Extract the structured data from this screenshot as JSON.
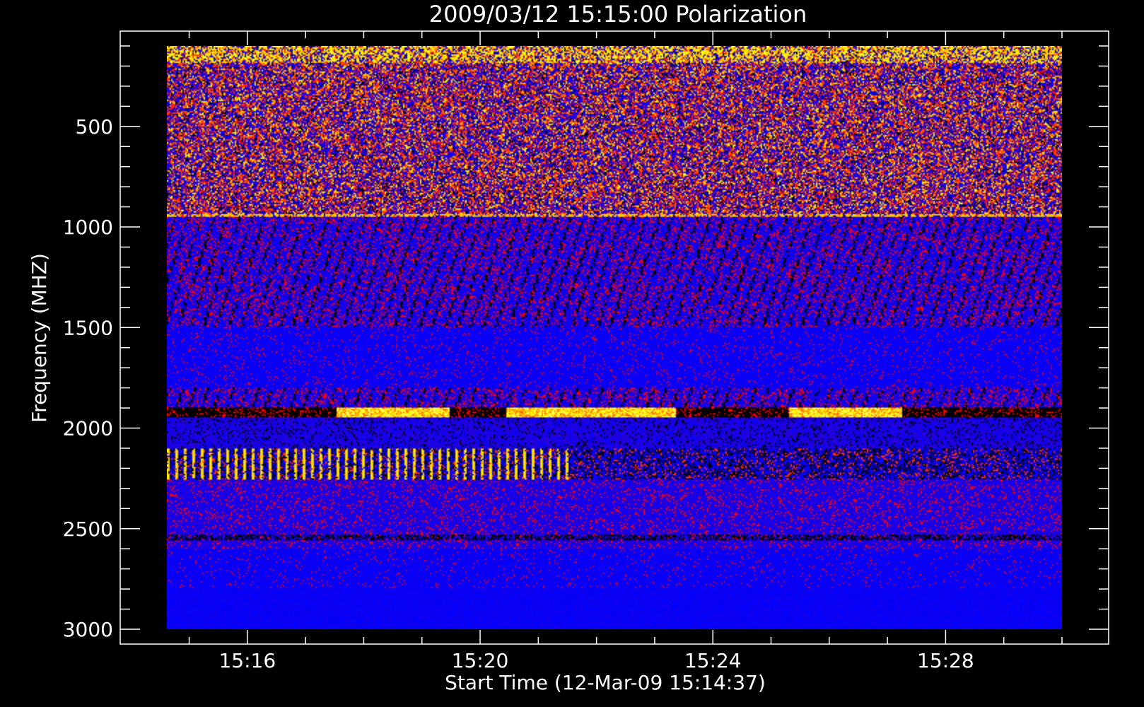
{
  "chart_data": {
    "type": "heatmap",
    "title": "2009/03/12 15:15:00 Polarization",
    "xlabel": "Start Time (12-Mar-09 15:14:37)",
    "ylabel": "Frequency (MHZ)",
    "x_range_minutes": [
      "15:14:37",
      "15:30:00"
    ],
    "y_range_mhz": [
      100,
      3000
    ],
    "y_axis_inverted": true,
    "x_ticks": [
      "15:16",
      "15:20",
      "15:24",
      "15:28"
    ],
    "x_tick_minutes": [
      16,
      20,
      24,
      28
    ],
    "y_ticks": [
      "500",
      "1000",
      "1500",
      "2000",
      "2500",
      "3000"
    ],
    "y_tick_values": [
      500,
      1000,
      1500,
      2000,
      2500,
      3000
    ],
    "colormap": [
      "#000000",
      "#0000ff",
      "#ff0000",
      "#ffff00",
      "#ffffff"
    ],
    "background_color": "#000000",
    "foreground_color": "#ffffff",
    "bands": [
      {
        "from_mhz": 100,
        "to_mhz": 950,
        "character": "noisy mixed polarization"
      },
      {
        "from_mhz": 950,
        "to_mhz": 1900,
        "character": "moderate"
      },
      {
        "from_mhz": 1900,
        "to_mhz": 1940,
        "character": "bright red/white patches"
      },
      {
        "from_mhz": 2100,
        "to_mhz": 2250,
        "character": "yellow periodic markers"
      },
      {
        "from_mhz": 2250,
        "to_mhz": 3000,
        "character": "mostly blue"
      }
    ]
  }
}
